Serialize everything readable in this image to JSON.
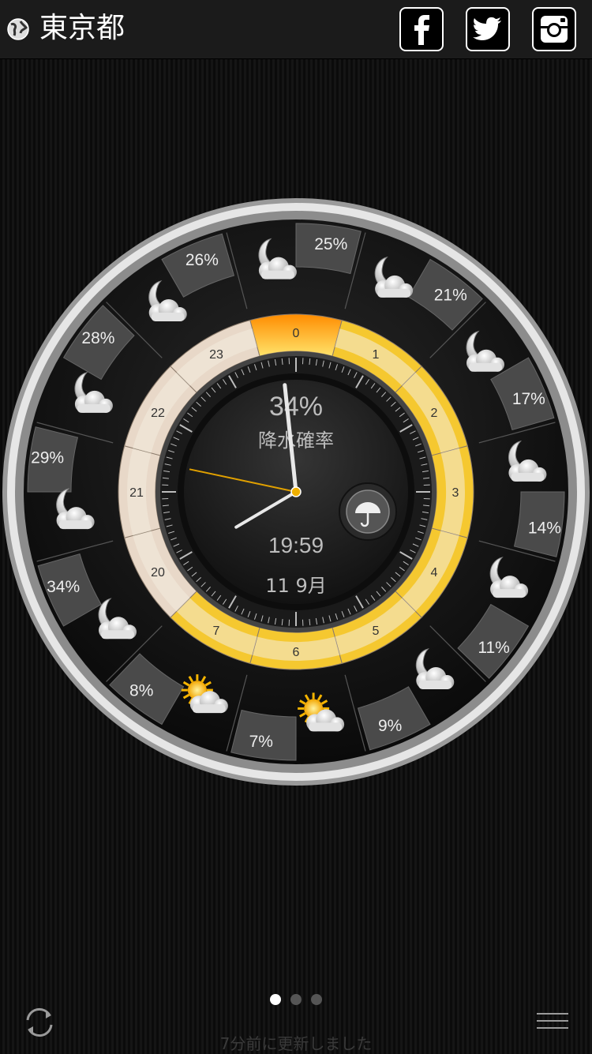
{
  "header": {
    "city": "東京都",
    "icons": [
      "globe-icon",
      "facebook-icon",
      "twitter-icon",
      "instagram-icon"
    ]
  },
  "dial": {
    "precip_percent": "34%",
    "precip_label": "降水確率",
    "time": "19:59",
    "date": "11 9月",
    "current_hour": 0,
    "hours": [
      {
        "hour": 0,
        "percent": "25%",
        "weather": "moon-cloud"
      },
      {
        "hour": 1,
        "percent": "21%",
        "weather": "moon-cloud"
      },
      {
        "hour": 2,
        "percent": "17%",
        "weather": "moon-cloud"
      },
      {
        "hour": 3,
        "percent": "14%",
        "weather": "moon-cloud"
      },
      {
        "hour": 4,
        "percent": "11%",
        "weather": "moon-cloud"
      },
      {
        "hour": 5,
        "percent": "9%",
        "weather": "moon-cloud"
      },
      {
        "hour": 6,
        "percent": "7%",
        "weather": "sun-cloud"
      },
      {
        "hour": 7,
        "percent": "8%",
        "weather": "sun-cloud"
      },
      {
        "hour": 20,
        "percent": "34%",
        "weather": "moon-cloud"
      },
      {
        "hour": 21,
        "percent": "29%",
        "weather": "moon-cloud"
      },
      {
        "hour": 22,
        "percent": "28%",
        "weather": "moon-cloud"
      },
      {
        "hour": 23,
        "percent": "26%",
        "weather": "moon-cloud"
      }
    ],
    "hour_ring_labels": [
      "0",
      "1",
      "2",
      "3",
      "4",
      "5",
      "6",
      "7",
      "20",
      "21",
      "22",
      "23"
    ],
    "colors": {
      "current": "#ff8c00",
      "ring_warm": "#f5c830",
      "ring_cool": "#e8d8c8",
      "bezel": "#c8c8c8"
    }
  },
  "pager": {
    "pages": 3,
    "active": 0
  },
  "footer": {
    "updated_text": "7分前に更新しました",
    "icons": [
      "refresh-icon",
      "menu-icon"
    ]
  }
}
